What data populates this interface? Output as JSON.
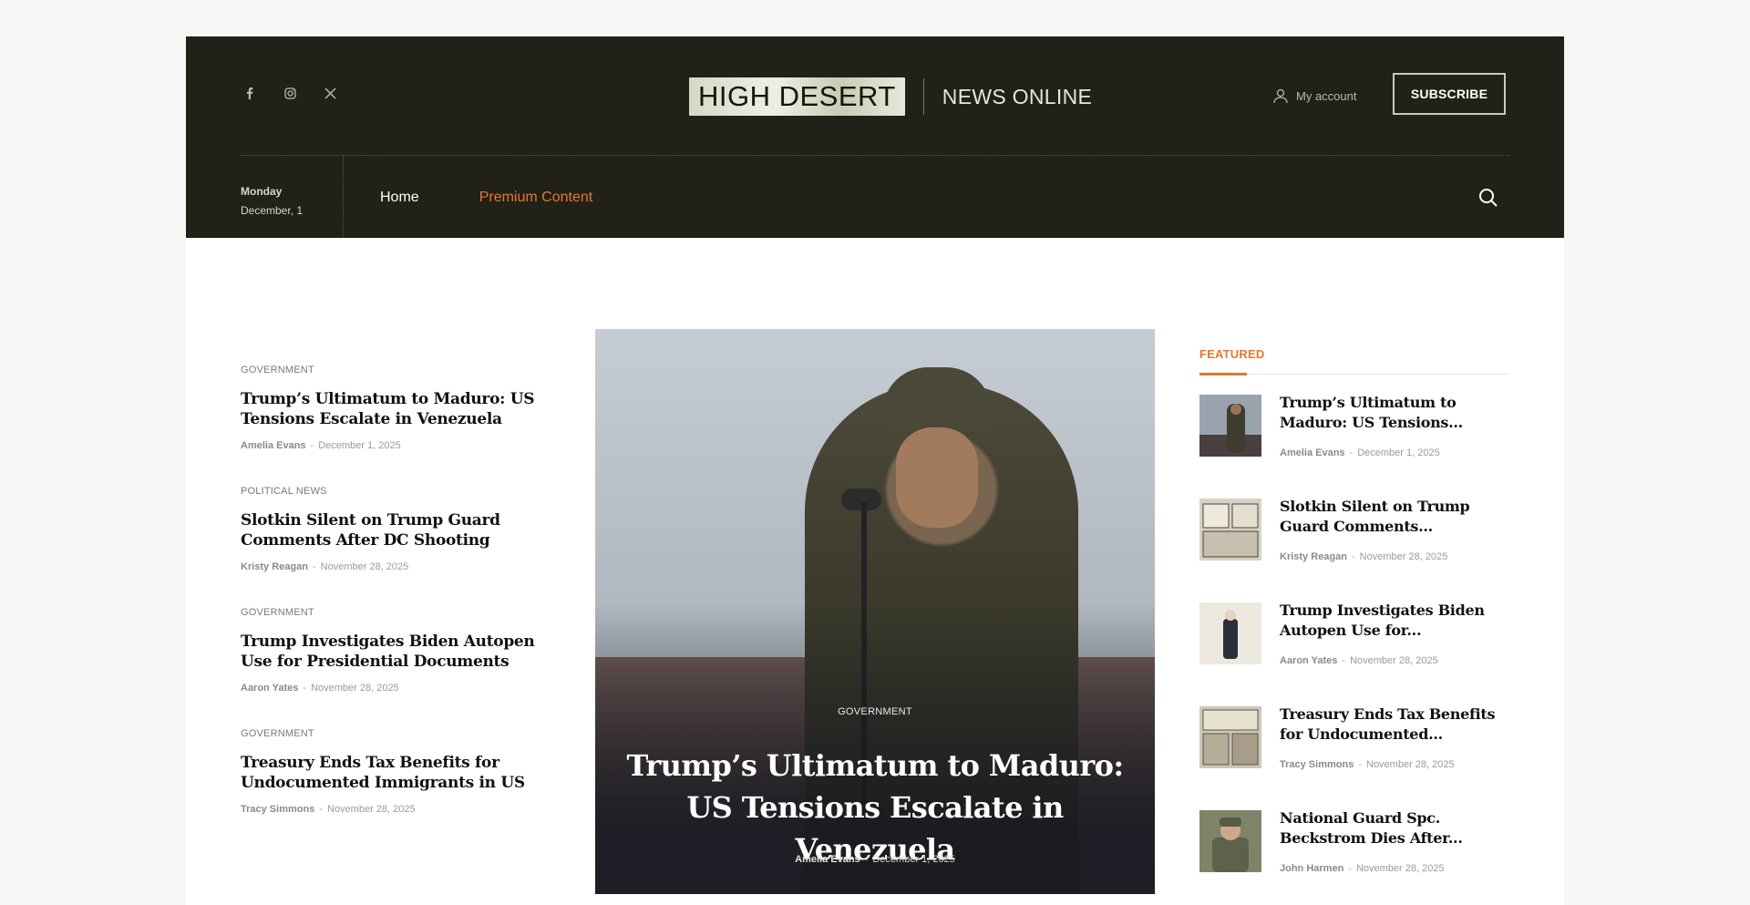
{
  "header": {
    "logo_main": "HIGH DESERT",
    "logo_sub": "NEWS ONLINE",
    "account_label": "My account",
    "subscribe_label": "SUBSCRIBE",
    "day": "Monday",
    "date": "December, 1",
    "social": [
      "facebook-icon",
      "instagram-icon",
      "x-icon"
    ]
  },
  "nav": {
    "home": "Home",
    "premium": "Premium Content",
    "accent_color": "#e6772e"
  },
  "left_articles": [
    {
      "category": "GOVERNMENT",
      "title": "Trump’s Ultimatum to Maduro: US Tensions Escalate in Venezuela",
      "author": "Amelia Evans",
      "sep": "-",
      "date": "December 1, 2025"
    },
    {
      "category": "POLITICAL NEWS",
      "title": "Slotkin Silent on Trump Guard Comments After DC Shooting",
      "author": "Kristy Reagan",
      "sep": "-",
      "date": "November 28, 2025"
    },
    {
      "category": "GOVERNMENT",
      "title": "Trump Investigates Biden Autopen Use for Presidential Documents",
      "author": "Aaron Yates",
      "sep": "-",
      "date": "November 28, 2025"
    },
    {
      "category": "GOVERNMENT",
      "title": "Treasury Ends Tax Benefits for Undocumented Immigrants in US",
      "author": "Tracy Simmons",
      "sep": "-",
      "date": "November 28, 2025"
    }
  ],
  "hero": {
    "category": "GOVERNMENT",
    "title": "Trump’s Ultimatum to Maduro: US Tensions Escalate in Venezuela",
    "author": "Amelia Evans",
    "sep": "-",
    "date": "December 1, 2025"
  },
  "featured": {
    "heading": "FEATURED",
    "items": [
      {
        "title": "Trump’s Ultimatum to Maduro: US Tensions...",
        "author": "Amelia Evans",
        "sep": "-",
        "date": "December 1, 2025"
      },
      {
        "title": "Slotkin Silent on Trump Guard Comments...",
        "author": "Kristy Reagan",
        "sep": "-",
        "date": "November 28, 2025"
      },
      {
        "title": "Trump Investigates Biden Autopen Use for...",
        "author": "Aaron Yates",
        "sep": "-",
        "date": "November 28, 2025"
      },
      {
        "title": "Treasury Ends Tax Benefits for Undocumented...",
        "author": "Tracy Simmons",
        "sep": "-",
        "date": "November 28, 2025"
      },
      {
        "title": "National Guard Spc. Beckstrom Dies After...",
        "author": "John Harmen",
        "sep": "-",
        "date": "November 28, 2025"
      }
    ]
  }
}
